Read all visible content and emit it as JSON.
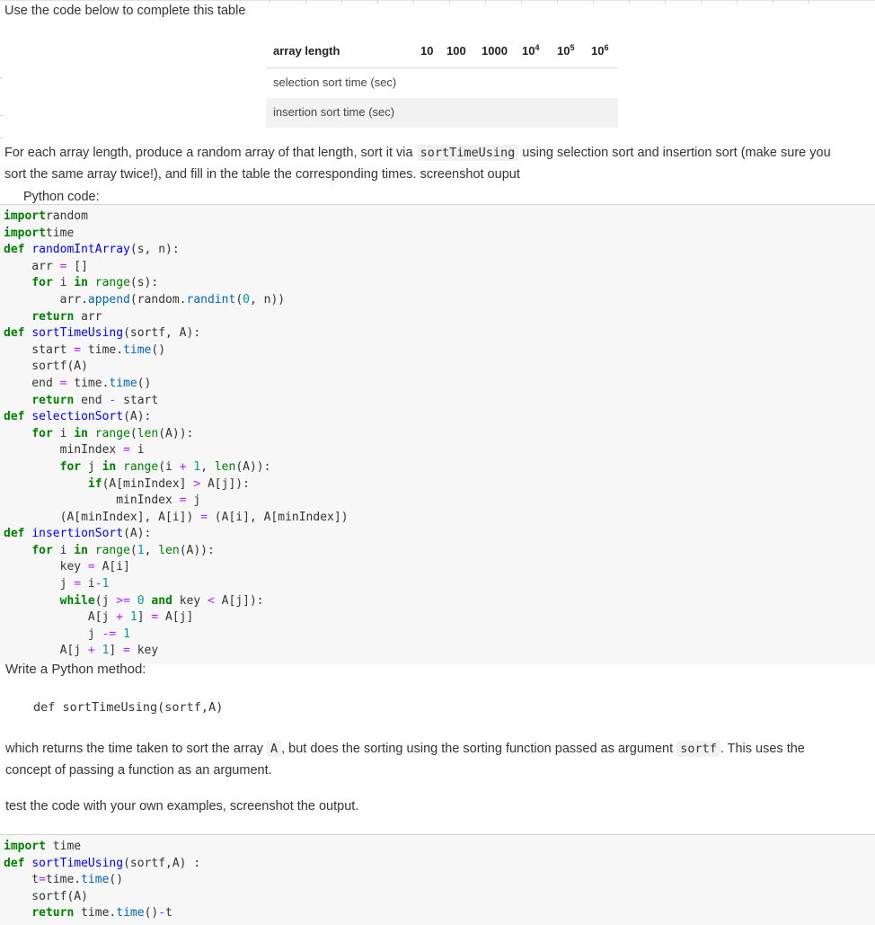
{
  "instruction_top": "Use the code below to complete this table",
  "table": {
    "header_label": "array length",
    "lengths": [
      {
        "base": "10",
        "exp": ""
      },
      {
        "base": "100",
        "exp": ""
      },
      {
        "base": "1000",
        "exp": ""
      },
      {
        "base": "10",
        "exp": "4"
      },
      {
        "base": "10",
        "exp": "5"
      },
      {
        "base": "10",
        "exp": "6"
      }
    ],
    "rows": [
      "selection sort time (sec)",
      "insertion sort time (sec)"
    ]
  },
  "paragraph1": {
    "part1": "For each array length, produce a random array of that length, sort it via ",
    "code": "sortTimeUsing",
    "part2": " using selection sort and insertion sort (make sure you",
    "line2": "sort the same array twice!), and fill in the table the corresponding times. screenshot ouput"
  },
  "python_caption": "Python code:",
  "code_lines": [
    [
      [
        "kw",
        "import"
      ],
      [
        "",
        "random"
      ]
    ],
    [
      [
        "kw",
        "import"
      ],
      [
        "",
        "time"
      ]
    ],
    [
      [
        "kw",
        "def"
      ],
      [
        "",
        " "
      ],
      [
        "fn",
        "randomIntArray"
      ],
      [
        "",
        "(s, n):"
      ]
    ],
    [
      [
        "",
        "    arr "
      ],
      [
        "op",
        "="
      ],
      [
        "",
        " []"
      ]
    ],
    [
      [
        "",
        "    "
      ],
      [
        "kw",
        "for"
      ],
      [
        "",
        " i "
      ],
      [
        "kw",
        "in"
      ],
      [
        "",
        " "
      ],
      [
        "bi",
        "range"
      ],
      [
        "",
        "(s):"
      ]
    ],
    [
      [
        "",
        "        arr."
      ],
      [
        "at",
        "append"
      ],
      [
        "",
        "(random."
      ],
      [
        "at",
        "randint"
      ],
      [
        "",
        "("
      ],
      [
        "nm",
        "0"
      ],
      [
        "",
        ", n))"
      ]
    ],
    [
      [
        "",
        "    "
      ],
      [
        "kw",
        "return"
      ],
      [
        "",
        " arr"
      ]
    ],
    [
      [
        "kw",
        "def"
      ],
      [
        "",
        " "
      ],
      [
        "fn",
        "sortTimeUsing"
      ],
      [
        "",
        "(sortf, A):"
      ]
    ],
    [
      [
        "",
        "    start "
      ],
      [
        "op",
        "="
      ],
      [
        "",
        " time."
      ],
      [
        "at",
        "time"
      ],
      [
        "",
        "()"
      ]
    ],
    [
      [
        "",
        "    sortf(A)"
      ]
    ],
    [
      [
        "",
        "    end "
      ],
      [
        "op",
        "="
      ],
      [
        "",
        " time."
      ],
      [
        "at",
        "time"
      ],
      [
        "",
        "()"
      ]
    ],
    [
      [
        "",
        "    "
      ],
      [
        "kw",
        "return"
      ],
      [
        "",
        " end "
      ],
      [
        "op",
        "-"
      ],
      [
        "",
        " start"
      ]
    ],
    [
      [
        "kw",
        "def"
      ],
      [
        "",
        " "
      ],
      [
        "fn",
        "selectionSort"
      ],
      [
        "",
        "(A):"
      ]
    ],
    [
      [
        "",
        "    "
      ],
      [
        "kw",
        "for"
      ],
      [
        "",
        " i "
      ],
      [
        "kw",
        "in"
      ],
      [
        "",
        " "
      ],
      [
        "bi",
        "range"
      ],
      [
        "",
        "("
      ],
      [
        "bi",
        "len"
      ],
      [
        "",
        "(A)):"
      ]
    ],
    [
      [
        "",
        "        minIndex "
      ],
      [
        "op",
        "="
      ],
      [
        "",
        " i"
      ]
    ],
    [
      [
        "",
        "        "
      ],
      [
        "kw",
        "for"
      ],
      [
        "",
        " j "
      ],
      [
        "kw",
        "in"
      ],
      [
        "",
        " "
      ],
      [
        "bi",
        "range"
      ],
      [
        "",
        "(i "
      ],
      [
        "op",
        "+"
      ],
      [
        "",
        " "
      ],
      [
        "nm",
        "1"
      ],
      [
        "",
        ", "
      ],
      [
        "bi",
        "len"
      ],
      [
        "",
        "(A)):"
      ]
    ],
    [
      [
        "",
        "            "
      ],
      [
        "kw",
        "if"
      ],
      [
        "",
        "(A[minIndex] "
      ],
      [
        "op",
        ">"
      ],
      [
        "",
        " A[j]):"
      ]
    ],
    [
      [
        "",
        "                minIndex "
      ],
      [
        "op",
        "="
      ],
      [
        "",
        " j"
      ]
    ],
    [
      [
        "",
        "        (A[minIndex], A[i]) "
      ],
      [
        "op",
        "="
      ],
      [
        "",
        " (A[i], A[minIndex])"
      ]
    ],
    [
      [
        "kw",
        "def"
      ],
      [
        "",
        " "
      ],
      [
        "fn",
        "insertionSort"
      ],
      [
        "",
        "(A):"
      ]
    ],
    [
      [
        "",
        "    "
      ],
      [
        "kw",
        "for"
      ],
      [
        "",
        " i "
      ],
      [
        "kw",
        "in"
      ],
      [
        "",
        " "
      ],
      [
        "bi",
        "range"
      ],
      [
        "",
        "("
      ],
      [
        "nm",
        "1"
      ],
      [
        "",
        ", "
      ],
      [
        "bi",
        "len"
      ],
      [
        "",
        "(A)):"
      ]
    ],
    [
      [
        "",
        "        key "
      ],
      [
        "op",
        "="
      ],
      [
        "",
        " A[i]"
      ]
    ],
    [
      [
        "",
        "        j "
      ],
      [
        "op",
        "="
      ],
      [
        "",
        " i"
      ],
      [
        "op",
        "-"
      ],
      [
        "nm",
        "1"
      ]
    ],
    [
      [
        "",
        "        "
      ],
      [
        "kw",
        "while"
      ],
      [
        "",
        "(j "
      ],
      [
        "op",
        ">="
      ],
      [
        "",
        " "
      ],
      [
        "nm",
        "0"
      ],
      [
        "",
        " "
      ],
      [
        "kw",
        "and"
      ],
      [
        "",
        " key "
      ],
      [
        "op",
        "<"
      ],
      [
        "",
        " A[j]):"
      ]
    ],
    [
      [
        "",
        "            A[j "
      ],
      [
        "op",
        "+"
      ],
      [
        "",
        " "
      ],
      [
        "nm",
        "1"
      ],
      [
        "",
        "] "
      ],
      [
        "op",
        "="
      ],
      [
        "",
        " A[j]"
      ]
    ],
    [
      [
        "",
        "            j "
      ],
      [
        "op",
        "-="
      ],
      [
        "",
        " "
      ],
      [
        "nm",
        "1"
      ]
    ],
    [
      [
        "",
        "        A[j "
      ],
      [
        "op",
        "+"
      ],
      [
        "",
        " "
      ],
      [
        "nm",
        "1"
      ],
      [
        "",
        "] "
      ],
      [
        "op",
        "="
      ],
      [
        "",
        " key"
      ]
    ]
  ],
  "write_method": "Write a Python method:",
  "method_signature": "def sortTimeUsing(sortf,A)",
  "paragraph2": {
    "part1": "which returns the time taken to sort the array ",
    "code1": "A",
    "part2": ", but does the sorting using the sorting function passed as argument ",
    "code2": "sortf",
    "part3": ". This uses the",
    "line2": "concept of passing a function as an argument."
  },
  "test_line": "test the code with your own examples, screenshot the output.",
  "code2_lines": [
    [
      [
        "kw",
        "import"
      ],
      [
        "",
        " time"
      ]
    ],
    [
      [
        "kw",
        "def"
      ],
      [
        "",
        " "
      ],
      [
        "fn",
        "sortTimeUsing"
      ],
      [
        "",
        "(sortf,A) :"
      ]
    ],
    [
      [
        "",
        "    t"
      ],
      [
        "op",
        "="
      ],
      [
        "",
        "time."
      ],
      [
        "at",
        "time"
      ],
      [
        "",
        "()"
      ]
    ],
    [
      [
        "",
        "    sortf(A)"
      ]
    ],
    [
      [
        "",
        "    "
      ],
      [
        "kw",
        "return"
      ],
      [
        "",
        " time."
      ],
      [
        "at",
        "time"
      ],
      [
        "",
        "()"
      ],
      [
        "op",
        "-"
      ],
      [
        "",
        "t"
      ]
    ]
  ]
}
